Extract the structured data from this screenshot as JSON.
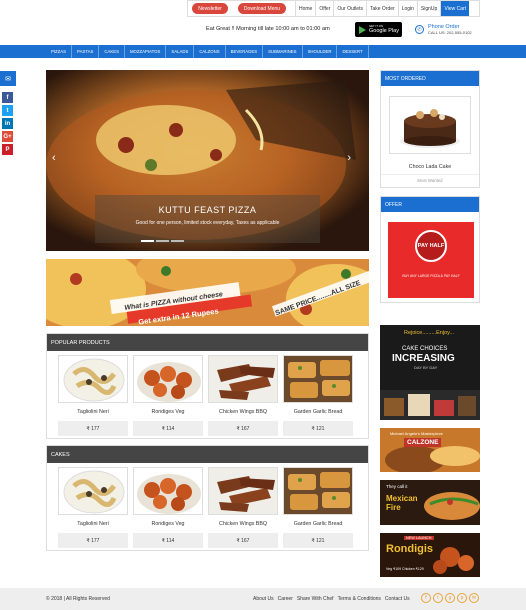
{
  "topbar": {
    "newsletter": "Newsletter",
    "download_menu": "Download Menu",
    "links": [
      "Home",
      "Offer",
      "Our Outlets",
      "Take Order",
      "Login",
      "SignUp"
    ],
    "view_cart": "View Cart"
  },
  "greeting": "Eat Great !! Morning till late 10:00 am to 01:00 am",
  "gplay": {
    "small": "GET IT ON",
    "big": "Google Play"
  },
  "phone": {
    "label": "Phone Order",
    "number": "CALL US: 202-555-0102"
  },
  "nav": [
    "PIZZAS",
    "PASTAS",
    "CAKES",
    "MOZZAPIATOS",
    "SALADS",
    "CALZONS",
    "BEVERAGES",
    "SUBMARINES",
    "SHOULDER",
    "DESSERT"
  ],
  "slider": {
    "title": "KUTTU FEAST PIZZA",
    "subtitle": "Good for one person, limited stock everyday, Taxes as applicable"
  },
  "banner": {
    "text1": "What is PIZZA without cheese",
    "text2": "Get extra in 12 Rupees",
    "text3": "SAME PRICE........ALL SIZE"
  },
  "popular": {
    "title": "POPULAR PRODUCTS",
    "items": [
      {
        "name": "Tagliolini Neri",
        "price": "₹ 177"
      },
      {
        "name": "Rondiges Veg",
        "price": "₹ 114"
      },
      {
        "name": "Chicken Wings BBQ",
        "price": "₹ 167"
      },
      {
        "name": "Garden Garlic Bread",
        "price": "₹ 121"
      }
    ]
  },
  "cakes": {
    "title": "CAKES",
    "items": [
      {
        "name": "Tagliolini Neri",
        "price": "₹ 177"
      },
      {
        "name": "Rondiges Veg",
        "price": "₹ 114"
      },
      {
        "name": "Chicken Wings BBQ",
        "price": "₹ 167"
      },
      {
        "name": "Garden Garlic Bread",
        "price": "₹ 121"
      }
    ]
  },
  "most_ordered": {
    "title": "MOST ORDERED",
    "name": "Choco Lada Cake",
    "sub": "Most Wanted"
  },
  "offer": {
    "title": "OFFER",
    "badge": "PAY HALF",
    "text": "BUY ANY LARGE PIZZA & PAY HALF"
  },
  "ads": {
    "cake_top": "Rejoice.........Enjoy...",
    "cake_mid": "CAKE CHOICES",
    "cake_big": "INCREASING",
    "cake_day": "DAY BY DAY",
    "calzone_top": "Michael Angelo's Masterpiece",
    "calzone": "CALZONE",
    "mexican_top": "They call it",
    "mexican": "Mexican Fire",
    "rondigis": "Rondigis",
    "rondigis_sub": "NEW LAUNCH",
    "rondigis_price": "Veg ₹109    Chicken ₹129"
  },
  "footer": {
    "copyright": "© 2018 | All Rights Reserved",
    "links": [
      "About Us",
      "Career",
      "Share With Chef",
      "Terms & Conditions",
      "Contact Us"
    ]
  },
  "colors": {
    "primary": "#1a6fd1",
    "accent": "#d9473c",
    "dark": "#454545"
  }
}
